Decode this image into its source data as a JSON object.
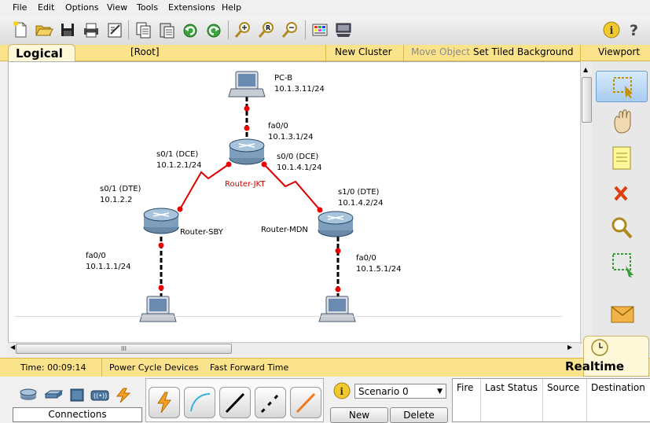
{
  "menu": [
    "File",
    "Edit",
    "Options",
    "View",
    "Tools",
    "Extensions",
    "Help"
  ],
  "toolbar": {
    "buttons": [
      "new-icon",
      "open-icon",
      "save-icon",
      "print-icon",
      "activity-wizard-icon",
      "copy-icon",
      "paste-icon",
      "undo-icon",
      "redo-icon",
      "zoom-in-icon",
      "zoom-reset-icon",
      "zoom-out-icon",
      "palette-icon",
      "custom-device-icon"
    ],
    "right_buttons": [
      "info-icon",
      "help-icon"
    ]
  },
  "logical_bar": {
    "tab_label": "Logical",
    "root": "[Root]",
    "new_cluster": "New Cluster",
    "move_object": "Move Object",
    "set_tiled_background": "Set Tiled Background",
    "viewport": "Viewport"
  },
  "topology": {
    "pc_b": {
      "name": "PC-B",
      "ip": "10.1.3.11/24"
    },
    "jkt_fa": {
      "iface": "fa0/0",
      "ip": "10.1.3.1/24"
    },
    "jkt_s01": {
      "iface": "s0/1 (DCE)",
      "ip": "10.1.2.1/24"
    },
    "jkt_s00": {
      "iface": "s0/0 (DCE)",
      "ip": "10.1.4.1/24"
    },
    "router_jkt": "Router-JKT",
    "sby_s01": {
      "iface": "s0/1 (DTE)",
      "ip": "10.1.2.2"
    },
    "mdn_s10": {
      "iface": "s1/0 (DTE)",
      "ip": "10.1.4.2/24"
    },
    "router_sby": "Router-SBY",
    "router_mdn": "Router-MDN",
    "sby_fa": {
      "iface": "fa0/0",
      "ip": "10.1.1.1/24"
    },
    "mdn_fa": {
      "iface": "fa0/0",
      "ip": "10.1.5.1/24"
    },
    "link_color_serial": "#dd0000",
    "link_color_ethernet": "#000000",
    "port_color": "#ee0000"
  },
  "hscroll_thumb_label": "III",
  "right_tools": [
    "select-icon",
    "move-layout-icon",
    "note-icon",
    "delete-icon",
    "inspect-icon",
    "resize-shape-icon",
    "add-simple-pdu-icon"
  ],
  "status": {
    "time": "Time: 00:09:14",
    "power_cycle": "Power Cycle Devices",
    "fast_forward": "Fast Forward Time",
    "realtime": "Realtime"
  },
  "bottom": {
    "connections_label": "Connections",
    "scenario": "Scenario 0",
    "new_button": "New",
    "delete_button": "Delete",
    "pdu_columns": [
      "Fire",
      "Last Status",
      "Source",
      "Destination"
    ]
  }
}
